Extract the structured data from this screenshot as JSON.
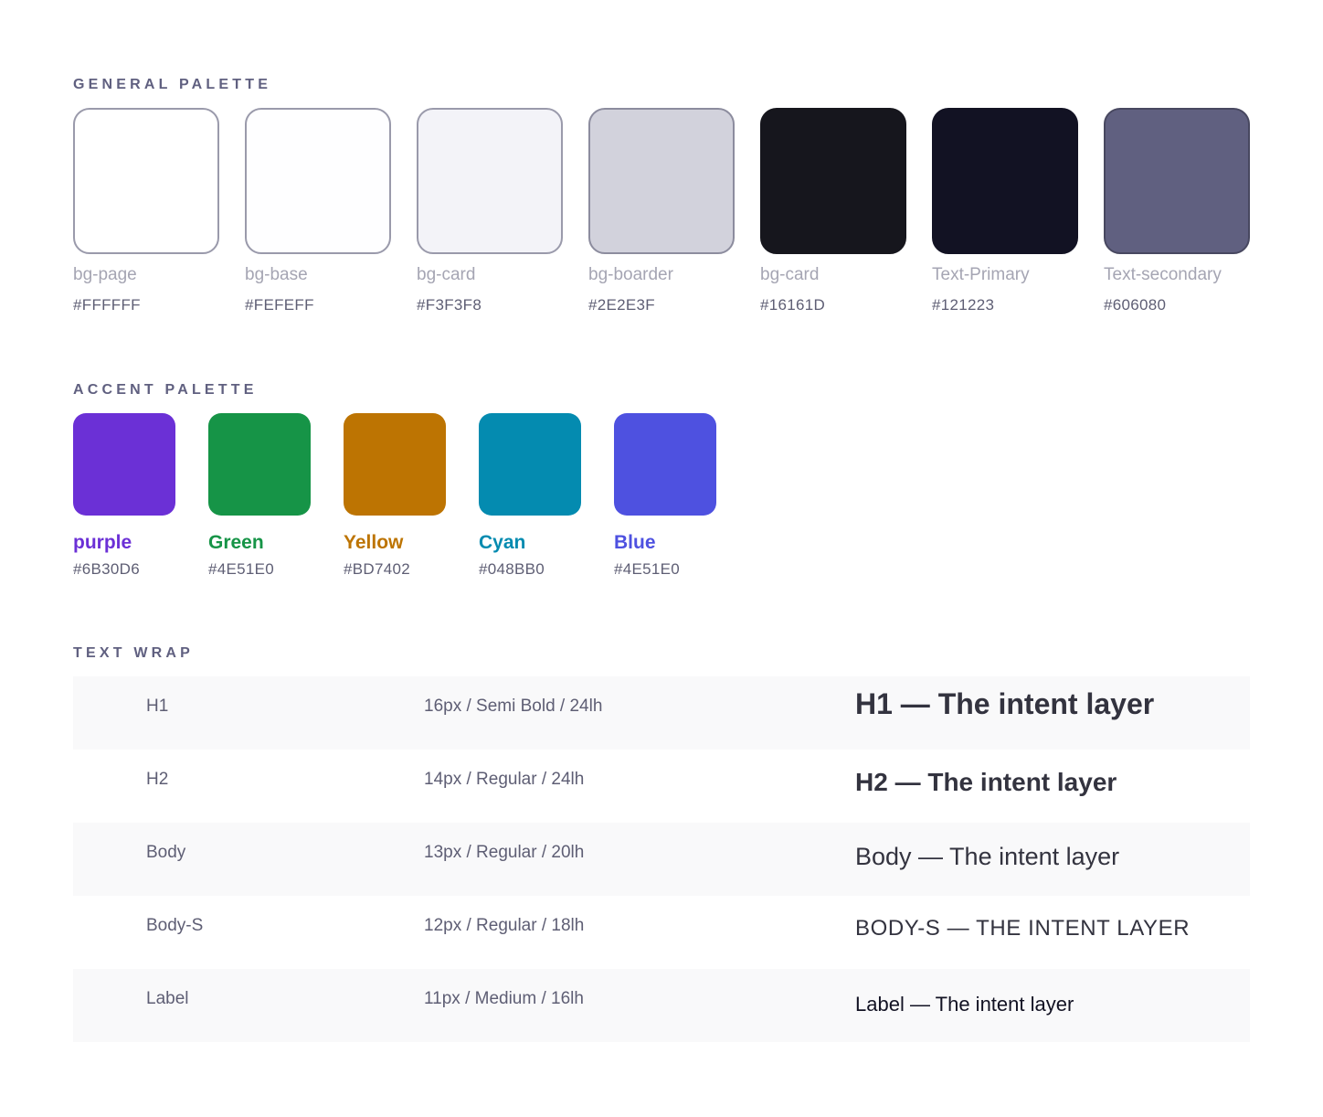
{
  "general": {
    "title": "GENERAL PALETTE",
    "swatches": [
      {
        "name": "bg-page",
        "hex": "#FFFFFF",
        "fill": "#FFFFFF",
        "border": "#9A9AAB"
      },
      {
        "name": "bg-base",
        "hex": "#FEFEFF",
        "fill": "#FEFEFF",
        "border": "#9A9AAB"
      },
      {
        "name": "bg-card",
        "hex": "#F3F3F8",
        "fill": "#F3F3F8",
        "border": "#9A9AAB"
      },
      {
        "name": "bg-boarder",
        "hex": "#2E2E3F",
        "fill": "#D2D2DC",
        "border": "#8C8C9E"
      },
      {
        "name": "bg-card",
        "hex": "#16161D",
        "fill": "#16161D",
        "border": "#16161D"
      },
      {
        "name": "Text-Primary",
        "hex": "#121223",
        "fill": "#121223",
        "border": "#121223"
      },
      {
        "name": "Text-secondary",
        "hex": "#606080",
        "fill": "#606080",
        "border": "#484860"
      }
    ]
  },
  "accent": {
    "title": "ACCENT PALETTE",
    "swatches": [
      {
        "name": "purple",
        "hex": "#6B30D6",
        "fill": "#6B30D6",
        "text": "#6B30D6"
      },
      {
        "name": "Green",
        "hex": "#4E51E0",
        "fill": "#169447",
        "text": "#169447"
      },
      {
        "name": "Yellow",
        "hex": "#BD7402",
        "fill": "#BD7402",
        "text": "#BD7402"
      },
      {
        "name": "Cyan",
        "hex": "#048BB0",
        "fill": "#048BB0",
        "text": "#048BB0"
      },
      {
        "name": "Blue",
        "hex": "#4E51E0",
        "fill": "#4E51E0",
        "text": "#4E51E0"
      }
    ]
  },
  "textwrap": {
    "title": "TEXT WRAP",
    "rows": [
      {
        "name": "H1",
        "spec": "16px / Semi Bold / 24lh",
        "sample": "H1 — The intent layer"
      },
      {
        "name": "H2",
        "spec": "14px / Regular / 24lh",
        "sample": "H2 — The intent layer"
      },
      {
        "name": "Body",
        "spec": "13px / Regular / 20lh",
        "sample": "Body — The intent layer"
      },
      {
        "name": "Body-S",
        "spec": "12px / Regular / 18lh",
        "sample": "BODY-S — THE INTENT LAYER"
      },
      {
        "name": "Label",
        "spec": "11px / Medium / 16lh",
        "sample": "Label — The intent layer"
      }
    ]
  }
}
